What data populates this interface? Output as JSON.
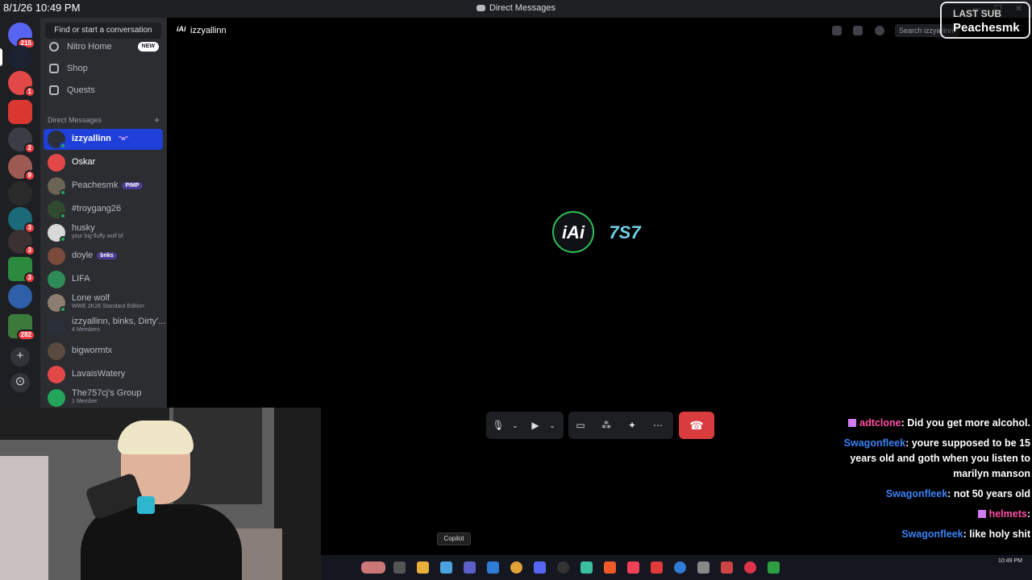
{
  "overlay_clock": "8/1/26 10:49 PM",
  "window": {
    "title": "Direct Messages"
  },
  "rail": {
    "home_badge": "215",
    "badges": [
      "1",
      "2",
      "9",
      "3",
      "3",
      "3",
      "282"
    ]
  },
  "sidebar": {
    "find_placeholder": "Find or start a conversation",
    "nav": [
      {
        "label": "Nitro Home",
        "badge": "NEW",
        "icon": "nitro-icon"
      },
      {
        "label": "Shop",
        "icon": "shop-icon"
      },
      {
        "label": "Quests",
        "icon": "quests-icon"
      }
    ],
    "dm_header": "Direct Messages",
    "dms": [
      {
        "name": "izzyallinn",
        "tag": "\"w\""
      },
      {
        "name": "Oskar"
      },
      {
        "name": "Peachesmk",
        "tag": "PIMP"
      },
      {
        "name": "#troygang26"
      },
      {
        "name": "husky",
        "sub": "your big fluffy wolf bf"
      },
      {
        "name": "doyle",
        "tag": "bnks"
      },
      {
        "name": "LIFA"
      },
      {
        "name": "Lone wolf",
        "sub": "WWE 2K26 Standard Edition"
      },
      {
        "name": "izzyallinn, binks, Dirty'...",
        "sub": "4 Members"
      },
      {
        "name": "bigwormtx"
      },
      {
        "name": "LavaisWatery"
      },
      {
        "name": "The757cj's Group",
        "sub": "1 Member"
      }
    ]
  },
  "main": {
    "header_name": "izzyallinn",
    "header_avatar_text": "iAi",
    "search_placeholder": "Search izzyallinn",
    "call_avatars": [
      "iAi",
      "7S7"
    ]
  },
  "last_sub": {
    "label": "LAST SUB",
    "name": "Peachesmk"
  },
  "chat": [
    {
      "user": "adtclone",
      "text": "Did you get more alcohol.",
      "color": "#ff4fa3"
    },
    {
      "user": "Swagonfleek",
      "text": "youre supposed to be 15 years old and goth when you listen to marilyn manson",
      "color": "#3b82f6"
    },
    {
      "user": "Swagonfleek",
      "text": "not 50 years old",
      "color": "#3b82f6"
    },
    {
      "user": "helmets",
      "text": "",
      "color": "#ff4fa3"
    },
    {
      "user": "Swagonfleek",
      "text": "like holy shit",
      "color": "#3b82f6"
    }
  ],
  "tooltip": "Copilot",
  "taskbar_time": "10:49 PM",
  "colors": {
    "accent_blue": "#1e3fd8",
    "hangup_red": "#d83c3e",
    "online_green": "#23a55a"
  }
}
